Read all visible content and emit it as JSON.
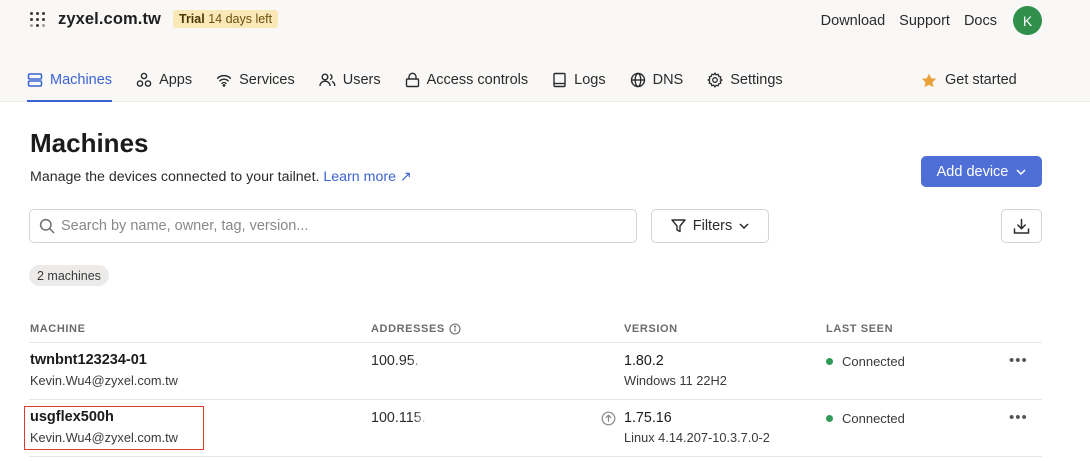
{
  "org": {
    "name": "zyxel.com.tw",
    "trial_label": "Trial",
    "trial_detail": "14 days left"
  },
  "top_links": {
    "download": "Download",
    "support": "Support",
    "docs": "Docs",
    "avatar_initial": "K"
  },
  "tabs": [
    {
      "label": "Machines",
      "icon": "machines-icon",
      "active": true
    },
    {
      "label": "Apps",
      "icon": "apps-icon"
    },
    {
      "label": "Services",
      "icon": "wifi-icon"
    },
    {
      "label": "Users",
      "icon": "users-icon"
    },
    {
      "label": "Access controls",
      "icon": "lock-icon"
    },
    {
      "label": "Logs",
      "icon": "book-icon"
    },
    {
      "label": "DNS",
      "icon": "globe-icon"
    },
    {
      "label": "Settings",
      "icon": "gear-icon"
    }
  ],
  "get_started": {
    "label": "Get started",
    "icon": "star-icon"
  },
  "page": {
    "title": "Machines",
    "description": "Manage the devices connected to your tailnet.",
    "learn_more": "Learn more ↗",
    "add_device": "Add device"
  },
  "search": {
    "placeholder": "Search by name, owner, tag, version...",
    "value": ""
  },
  "filters_label": "Filters",
  "machine_count": "2 machines",
  "columns": {
    "machine": "MACHINE",
    "addresses": "ADDRESSES",
    "version": "VERSION",
    "last_seen": "LAST SEEN"
  },
  "machines": [
    {
      "name": "twnbnt123234-01",
      "owner": "Kevin.Wu4@zyxel.com.tw",
      "address": "100.95.",
      "version": "1.80.2",
      "os": "Windows 11 22H2",
      "status": "Connected",
      "update_available": false
    },
    {
      "name": "usgflex500h",
      "owner": "Kevin.Wu4@zyxel.com.tw",
      "address": "100.115.",
      "version": "1.75.16",
      "os": "Linux 4.14.207-10.3.7.0-2",
      "status": "Connected",
      "update_available": true
    }
  ],
  "more_label": "•••",
  "colors": {
    "accent": "#3b63d4",
    "primary_button": "#4e6fd6",
    "connected": "#2f9a57",
    "avatar": "#2f8f4b",
    "highlight": "#e03c2e",
    "trial_bg": "#fbe8b8"
  }
}
